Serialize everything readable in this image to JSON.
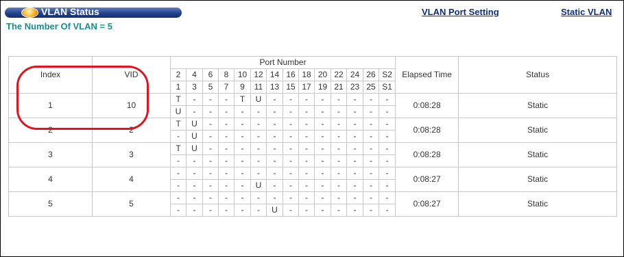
{
  "header": {
    "title": "VLAN Status",
    "vlan_count": "The Number Of VLAN = 5",
    "link_port_setting": "VLAN Port Setting",
    "link_static_vlan": "Static VLAN"
  },
  "table": {
    "col_index": "Index",
    "col_vid": "VID",
    "col_port_number": "Port Number",
    "col_elapsed": "Elapsed Time",
    "col_status": "Status",
    "ports_top": [
      "2",
      "4",
      "6",
      "8",
      "10",
      "12",
      "14",
      "16",
      "18",
      "20",
      "22",
      "24",
      "26",
      "S2"
    ],
    "ports_bottom": [
      "1",
      "3",
      "5",
      "7",
      "9",
      "11",
      "13",
      "15",
      "17",
      "19",
      "21",
      "23",
      "25",
      "S1"
    ],
    "rows": [
      {
        "index": "1",
        "vid": "10",
        "elapsed": "0:08:28",
        "status": "Static",
        "top": [
          "T",
          "-",
          "-",
          "-",
          "T",
          "U",
          "-",
          "-",
          "-",
          "-",
          "-",
          "-",
          "-",
          "-"
        ],
        "bottom": [
          "U",
          "-",
          "-",
          "-",
          "-",
          "-",
          "-",
          "-",
          "-",
          "-",
          "-",
          "-",
          "-",
          "-"
        ]
      },
      {
        "index": "2",
        "vid": "2",
        "elapsed": "0:08:28",
        "status": "Static",
        "top": [
          "T",
          "U",
          "-",
          "-",
          "-",
          "-",
          "-",
          "-",
          "-",
          "-",
          "-",
          "-",
          "-",
          "-"
        ],
        "bottom": [
          "-",
          "U",
          "-",
          "-",
          "-",
          "-",
          "-",
          "-",
          "-",
          "-",
          "-",
          "-",
          "-",
          "-"
        ]
      },
      {
        "index": "3",
        "vid": "3",
        "elapsed": "0:08:28",
        "status": "Static",
        "top": [
          "T",
          "U",
          "-",
          "-",
          "-",
          "-",
          "-",
          "-",
          "-",
          "-",
          "-",
          "-",
          "-",
          "-"
        ],
        "bottom": [
          "-",
          "-",
          "-",
          "-",
          "-",
          "-",
          "-",
          "-",
          "-",
          "-",
          "-",
          "-",
          "-",
          "-"
        ]
      },
      {
        "index": "4",
        "vid": "4",
        "elapsed": "0:08:27",
        "status": "Static",
        "top": [
          "-",
          "-",
          "-",
          "-",
          "-",
          "-",
          "-",
          "-",
          "-",
          "-",
          "-",
          "-",
          "-",
          "-"
        ],
        "bottom": [
          "-",
          "-",
          "-",
          "-",
          "-",
          "U",
          "-",
          "-",
          "-",
          "-",
          "-",
          "-",
          "-",
          "-"
        ]
      },
      {
        "index": "5",
        "vid": "5",
        "elapsed": "0:08:27",
        "status": "Static",
        "top": [
          "-",
          "-",
          "-",
          "-",
          "-",
          "-",
          "-",
          "-",
          "-",
          "-",
          "-",
          "-",
          "-",
          "-"
        ],
        "bottom": [
          "-",
          "-",
          "-",
          "-",
          "-",
          "-",
          "U",
          "-",
          "-",
          "-",
          "-",
          "-",
          "-",
          "-"
        ]
      }
    ]
  },
  "colors": {
    "title_bar": "#23428a",
    "count_text": "#1a8c8c",
    "link_text": "#0b2f86",
    "highlight": "#e0141e"
  },
  "icons": {
    "title_icon": "orange-orb-icon"
  }
}
